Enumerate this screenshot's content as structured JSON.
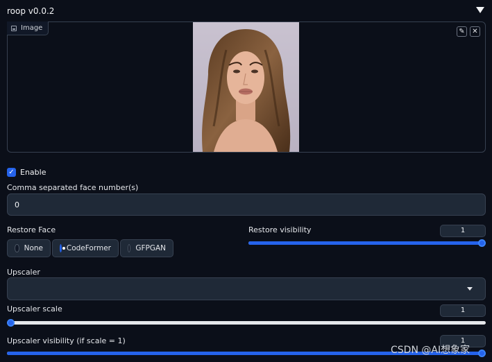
{
  "header": {
    "title": "roop v0.0.2"
  },
  "image_panel": {
    "tag_label": "Image",
    "edit_symbol": "✎",
    "close_symbol": "✕"
  },
  "enable": {
    "label": "Enable",
    "checked": true,
    "check_symbol": "✓"
  },
  "face_numbers": {
    "label": "Comma separated face number(s)",
    "value": "0"
  },
  "restore_face": {
    "label": "Restore Face",
    "options": [
      "None",
      "CodeFormer",
      "GFPGAN"
    ],
    "selected": "CodeFormer"
  },
  "restore_visibility": {
    "label": "Restore visibility",
    "value": "1",
    "fraction": 1.0
  },
  "upscaler": {
    "label": "Upscaler",
    "value": ""
  },
  "upscaler_scale": {
    "label": "Upscaler scale",
    "value": "1",
    "fraction": 0.0
  },
  "upscaler_visibility": {
    "label": "Upscaler visibility (if scale = 1)",
    "value": "1",
    "fraction": 1.0
  },
  "watermark": {
    "text": "CSDN @AI想象家"
  },
  "colors": {
    "accent": "#2563eb",
    "background": "#0b0f19",
    "panel": "#1f2937",
    "border": "#374151"
  },
  "icons": [
    "collapse-triangle-icon",
    "image-icon",
    "edit-icon",
    "close-icon",
    "check-icon",
    "dropdown-arrow-icon"
  ]
}
